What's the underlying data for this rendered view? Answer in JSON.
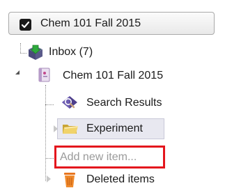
{
  "notebook_selector": {
    "label": "Chem 101 Fall 2015",
    "checked": true
  },
  "tree": {
    "inbox": {
      "label": "Inbox (7)",
      "icon": "inbox-icon"
    },
    "notebook": {
      "label": "Chem 101 Fall 2015",
      "icon": "notebook-icon",
      "expanded": true,
      "children": {
        "search_results": {
          "label": "Search Results",
          "icon": "search-results-icon"
        },
        "experiment": {
          "label": "Experiment",
          "icon": "folder-icon",
          "selected": true
        },
        "add_item": {
          "placeholder": "Add new item..."
        },
        "deleted_items": {
          "label": "Deleted items",
          "icon": "trash-icon"
        }
      }
    }
  },
  "colors": {
    "highlight_border": "#e4161d",
    "selection_background": "#e8e8f0"
  }
}
